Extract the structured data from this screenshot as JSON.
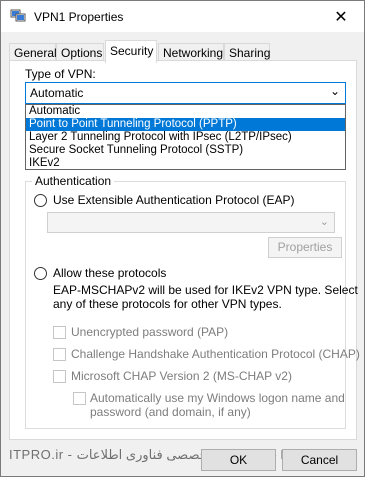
{
  "window": {
    "title": "VPN1 Properties",
    "close_glyph": "✕"
  },
  "tabs": [
    {
      "label": "General"
    },
    {
      "label": "Options"
    },
    {
      "label": "Security"
    },
    {
      "label": "Networking"
    },
    {
      "label": "Sharing"
    }
  ],
  "security": {
    "vpn_type_label": "Type of VPN:",
    "vpn_type_value": "Automatic",
    "vpn_type_options": [
      "Automatic",
      "Point to Point Tunneling Protocol (PPTP)",
      "Layer 2 Tunneling Protocol with IPsec (L2TP/IPsec)",
      "Secure Socket Tunneling Protocol (SSTP)",
      "IKEv2"
    ],
    "highlighted_option": "Point to Point Tunneling Protocol (PPTP)",
    "authentication": {
      "title": "Authentication",
      "eap_label": "Use Extensible Authentication Protocol (EAP)",
      "properties_button": "Properties",
      "allow_protocols_label": "Allow these protocols",
      "note_line1": "EAP-MSCHAPv2 will be used for IKEv2 VPN type. Select",
      "note_line2": "any of these protocols for other VPN types.",
      "pap_label": "Unencrypted password (PAP)",
      "chap_label": "Challenge Handshake Authentication Protocol (CHAP)",
      "mschap_label": "Microsoft CHAP Version 2 (MS-CHAP v2)",
      "autologon_line1": "Automatically use my Windows logon name and",
      "autologon_line2": "password (and domain, if any)"
    }
  },
  "footer": {
    "ok_label": "OK",
    "cancel_label": "Cancel",
    "watermark": "ITPRO.ir - وب سایت تخصصی فناوری اطلاعات - ITPRO.ir"
  }
}
